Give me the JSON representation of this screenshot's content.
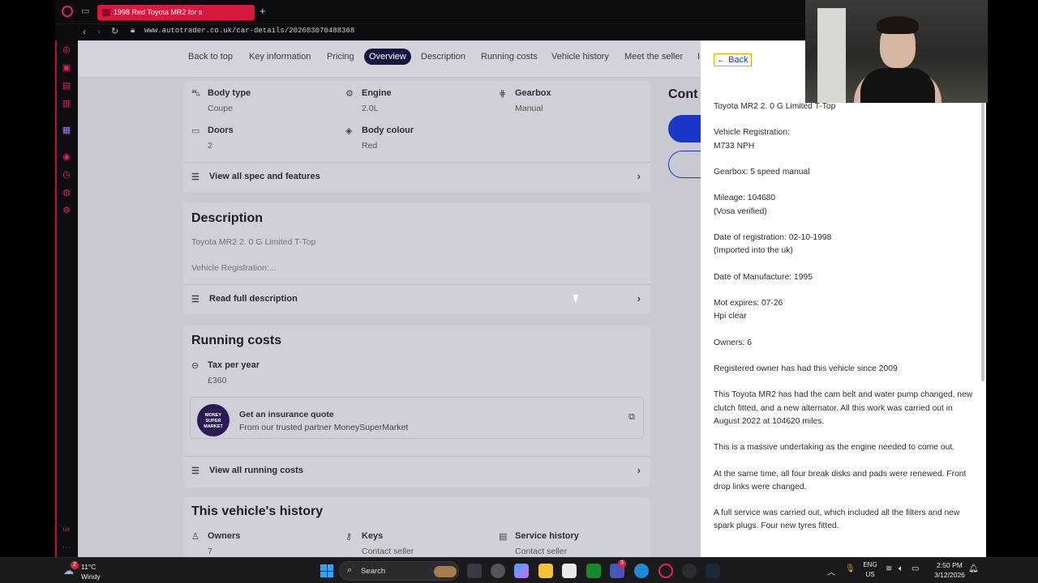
{
  "browser": {
    "tab_title": "1998 Red Toyota MR2 for s",
    "url": "www.autotrader.co.uk/car-details/202603070488368",
    "new_tab_symbol": "+"
  },
  "subnav": {
    "items": [
      "Back to top",
      "Key information",
      "Pricing",
      "Overview",
      "Description",
      "Running costs",
      "Vehicle history",
      "Meet the seller"
    ],
    "active": "Overview",
    "overflow": "I"
  },
  "specs": [
    {
      "label": "Body type",
      "value": "Coupe",
      "icon": "car-icon"
    },
    {
      "label": "Engine",
      "value": "2.0L",
      "icon": "engine-icon"
    },
    {
      "label": "Gearbox",
      "value": "Manual",
      "icon": "gearbox-icon"
    },
    {
      "label": "Doors",
      "value": "2",
      "icon": "door-icon"
    },
    {
      "label": "Body colour",
      "value": "Red",
      "icon": "paint-icon"
    }
  ],
  "spec_link": "View all spec and features",
  "description": {
    "heading": "Description",
    "line1": "Toyota MR2 2. 0 G Limited T-Top",
    "line2": "Vehicle Registration:...",
    "link": "Read full description"
  },
  "running_costs": {
    "heading": "Running costs",
    "tax_label": "Tax per year",
    "tax_value": "£360",
    "insurance_title": "Get an insurance quote",
    "insurance_sub": "From our trusted partner MoneySuperMarket",
    "logo_text": "MONEY SUPER MARKET",
    "link": "View all running costs"
  },
  "history": {
    "heading": "This vehicle's history",
    "items": [
      {
        "label": "Owners",
        "value": "7"
      },
      {
        "label": "Keys",
        "value": "Contact seller"
      },
      {
        "label": "Service history",
        "value": "Contact seller"
      }
    ]
  },
  "contact": {
    "heading": "Cont"
  },
  "panel": {
    "back_label": "Back",
    "paragraphs": [
      "Toyota MR2 2. 0 G Limited T-Top",
      "Vehicle Registration:\nM733 NPH",
      "Gearbox: 5 speed manual",
      "Mileage: 104680\n(Vosa verified)",
      "Date of registration: 02-10-1998\n(Imported into the uk)",
      "Date of Manufacture: 1995",
      "Mot expires: 07-26\nHpi clear",
      "Owners: 6",
      "Registered owner has had this vehicle since 2009",
      "This Toyota MR2 has had the cam belt and water pump changed, new clutch fitted, and a new alternator. All this work was carried out in August 2022 at 104620 miles.",
      "This is a massive undertaking as the engine needed to come out.",
      "At the same time, all four break disks and pads were renewed. Front drop links were changed.",
      "A full service was carried out, which included all the filters and new spark plugs. Four new tyres fitted."
    ]
  },
  "taskbar": {
    "weather_temp": "11°C",
    "weather_cond": "Windy",
    "weather_badge": "2",
    "search_placeholder": "Search",
    "lang_top": "ENG",
    "lang_bottom": "US",
    "time": "2:50 PM",
    "date": "3/12/2026",
    "app_badge": "3"
  },
  "colors": {
    "opera_red": "#d8193f",
    "accent_blue": "#1a37c8",
    "nav_active": "#16163f"
  }
}
